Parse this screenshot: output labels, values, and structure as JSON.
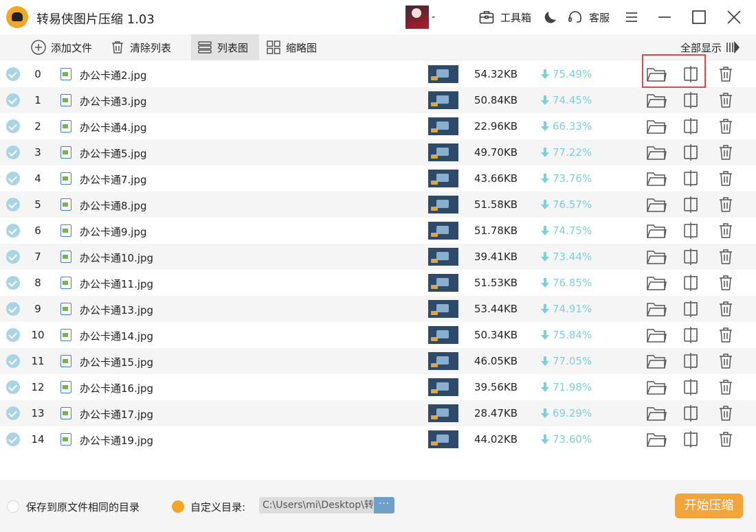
{
  "app": {
    "title": "转易侠图片压缩 1.03",
    "username": "-"
  },
  "header": {
    "toolbox_label": "工具箱",
    "service_label": "客服"
  },
  "toolbar": {
    "add_file": "添加文件",
    "clear_list": "清除列表",
    "list_view": "列表图",
    "thumb_view": "缩略图",
    "show_all": "全部显示"
  },
  "files": [
    {
      "index": "0",
      "name": "办公卡通2.jpg",
      "size": "54.32KB",
      "ratio": "75.49%"
    },
    {
      "index": "1",
      "name": "办公卡通3.jpg",
      "size": "50.84KB",
      "ratio": "74.45%"
    },
    {
      "index": "2",
      "name": "办公卡通4.jpg",
      "size": "22.96KB",
      "ratio": "66.33%"
    },
    {
      "index": "3",
      "name": "办公卡通5.jpg",
      "size": "49.70KB",
      "ratio": "77.22%"
    },
    {
      "index": "4",
      "name": "办公卡通7.jpg",
      "size": "43.66KB",
      "ratio": "73.76%"
    },
    {
      "index": "5",
      "name": "办公卡通8.jpg",
      "size": "51.58KB",
      "ratio": "76.57%"
    },
    {
      "index": "6",
      "name": "办公卡通9.jpg",
      "size": "51.78KB",
      "ratio": "74.75%"
    },
    {
      "index": "7",
      "name": "办公卡通10.jpg",
      "size": "39.41KB",
      "ratio": "73.44%"
    },
    {
      "index": "8",
      "name": "办公卡通11.jpg",
      "size": "51.53KB",
      "ratio": "76.85%"
    },
    {
      "index": "9",
      "name": "办公卡通13.jpg",
      "size": "53.44KB",
      "ratio": "74.91%"
    },
    {
      "index": "10",
      "name": "办公卡通14.jpg",
      "size": "50.34KB",
      "ratio": "75.84%"
    },
    {
      "index": "11",
      "name": "办公卡通15.jpg",
      "size": "46.05KB",
      "ratio": "77.05%"
    },
    {
      "index": "12",
      "name": "办公卡通16.jpg",
      "size": "39.56KB",
      "ratio": "71.98%"
    },
    {
      "index": "13",
      "name": "办公卡通17.jpg",
      "size": "28.47KB",
      "ratio": "69.29%"
    },
    {
      "index": "14",
      "name": "办公卡通19.jpg",
      "size": "44.02KB",
      "ratio": "73.60%"
    }
  ],
  "footer": {
    "same_dir_label": "保存到原文件相同的目录",
    "custom_dir_label": "自定义目录:",
    "path_value": "C:\\Users\\mi\\Desktop\\转",
    "browse_label": "···",
    "start_button": "开始压缩"
  },
  "colors": {
    "accent": "#f3a43a",
    "ratio": "#7ed0d8",
    "check": "#a9d5e2",
    "highlight": "#e8434b"
  }
}
